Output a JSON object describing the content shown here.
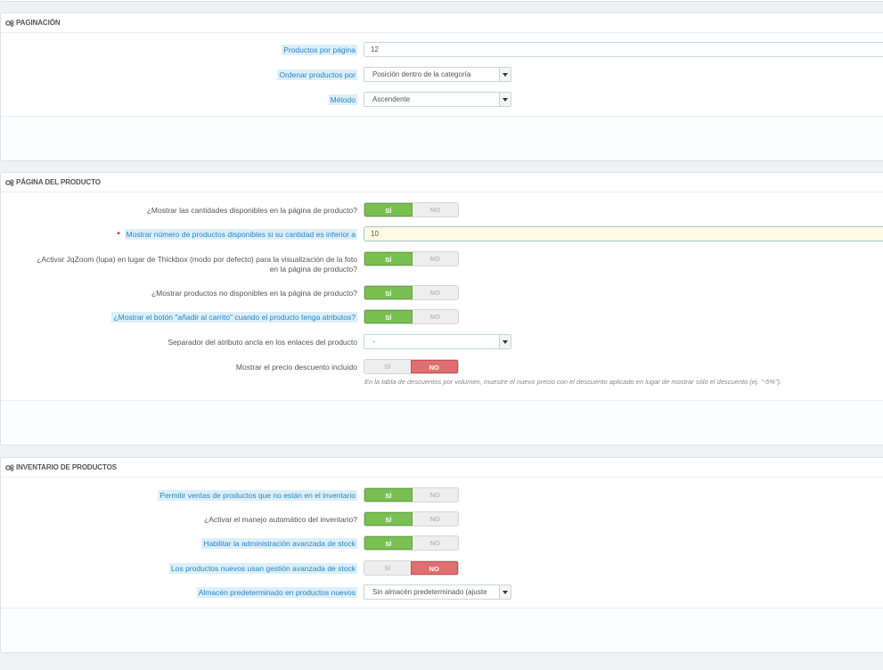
{
  "pagination": {
    "title": "PAGINACIÓN",
    "products_per_page_label": "Productos por página",
    "products_per_page_value": "12",
    "order_by_label": "Ordenar productos por",
    "order_by_value": "Posición dentro de la categoría",
    "method_label": "Método",
    "method_value": "Ascendente"
  },
  "product_page": {
    "title": "PÁGINA DEL PRODUCTO",
    "yes": "SÍ",
    "no": "NO",
    "show_qty_label": "¿Mostrar las cantidades disponibles en la página de producto?",
    "show_qty_value": "yes",
    "low_stock_label": "Mostrar número de productos disponibles si su cantidad es inferior a",
    "low_stock_value": "10",
    "jqzoom_label_1": "¿Activar JqZoom (lupa) en lugar de Thickbox (modo por defecto) para la visualización de la foto",
    "jqzoom_label_2": "en la página de producto?",
    "jqzoom_value": "yes",
    "show_unavailable_label": "¿Mostrar productos no disponibles en la página de producto?",
    "show_unavailable_value": "yes",
    "add_to_cart_label": "¿Mostrar el botón \"añadir al carrito\" cuando el producto tenga atributos?",
    "add_to_cart_value": "yes",
    "separator_label": "Separador del atributo ancla en los enlaces del producto",
    "separator_value": "-",
    "discount_price_label": "Mostrar el precio descuento incluido",
    "discount_price_value": "no",
    "discount_price_help": "En la tabla de descuentos por volumen, muestre el nuevo precio con el descuento aplicado en lugar de mostrar sólo el descuento (ej. \"-5%\")."
  },
  "inventory": {
    "title": "INVENTARIO DE PRODUCTOS",
    "allow_oos_label": "Permitir ventas de productos que no están en el inventario",
    "allow_oos_value": "yes",
    "auto_stock_label": "¿Activar el manejo automático del inventario?",
    "auto_stock_value": "yes",
    "advanced_stock_label": "Habilitar la administración avanzada de stock",
    "advanced_stock_value": "yes",
    "new_products_asm_label": "Los productos nuevos usan gestión avanzada de stock",
    "new_products_asm_value": "no",
    "default_warehouse_label": "Almacén predeterminado en productos nuevos",
    "default_warehouse_value": "Sin almacén predeterminado (ajuste"
  }
}
